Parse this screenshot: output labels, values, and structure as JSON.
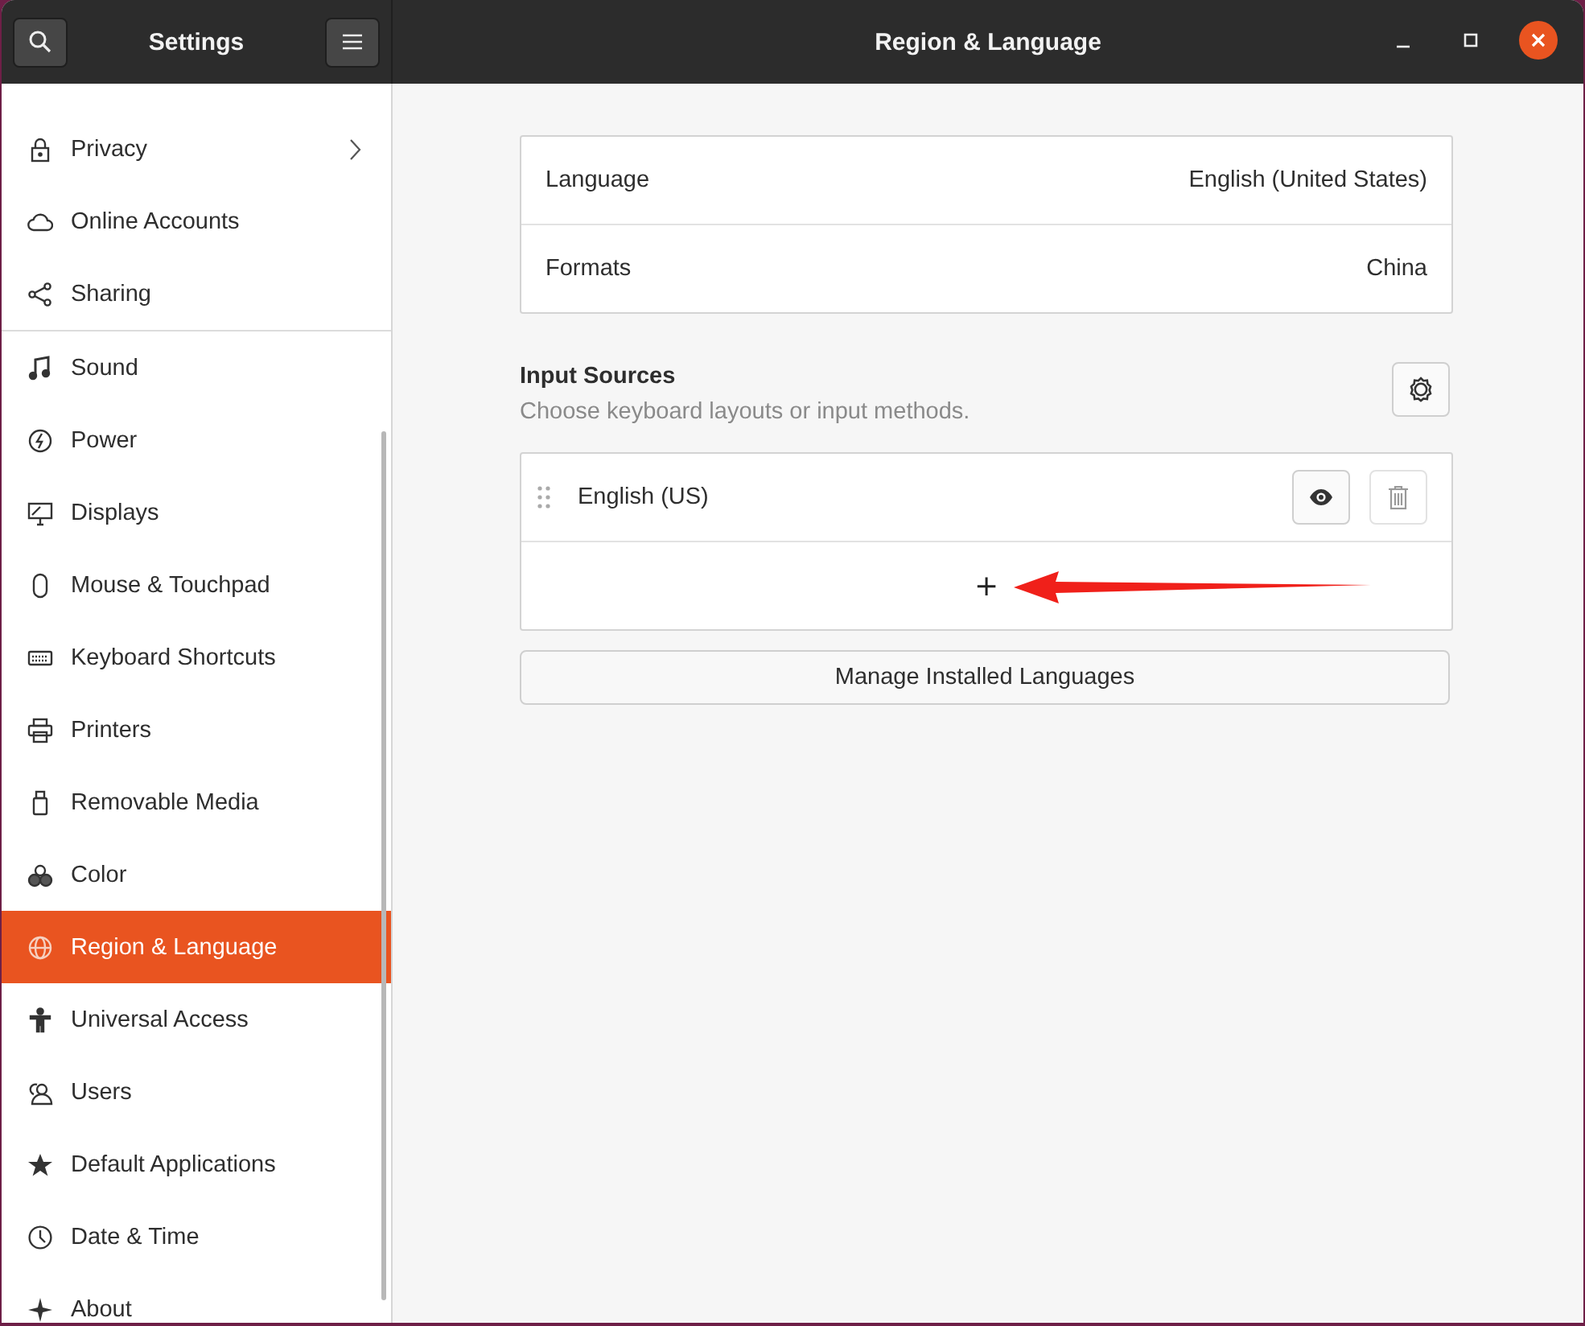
{
  "sidebar": {
    "title": "Settings",
    "items": [
      {
        "label": "Privacy",
        "has_arrow": true,
        "selected": false,
        "separator_after": false
      },
      {
        "label": "Online Accounts",
        "has_arrow": false,
        "selected": false,
        "separator_after": false
      },
      {
        "label": "Sharing",
        "has_arrow": false,
        "selected": false,
        "separator_after": true
      },
      {
        "label": "Sound",
        "has_arrow": false,
        "selected": false,
        "separator_after": false
      },
      {
        "label": "Power",
        "has_arrow": false,
        "selected": false,
        "separator_after": false
      },
      {
        "label": "Displays",
        "has_arrow": false,
        "selected": false,
        "separator_after": false
      },
      {
        "label": "Mouse & Touchpad",
        "has_arrow": false,
        "selected": false,
        "separator_after": false
      },
      {
        "label": "Keyboard Shortcuts",
        "has_arrow": false,
        "selected": false,
        "separator_after": false
      },
      {
        "label": "Printers",
        "has_arrow": false,
        "selected": false,
        "separator_after": false
      },
      {
        "label": "Removable Media",
        "has_arrow": false,
        "selected": false,
        "separator_after": false
      },
      {
        "label": "Color",
        "has_arrow": false,
        "selected": false,
        "separator_after": false
      },
      {
        "label": "Region & Language",
        "has_arrow": false,
        "selected": true,
        "separator_after": false
      },
      {
        "label": "Universal Access",
        "has_arrow": false,
        "selected": false,
        "separator_after": false
      },
      {
        "label": "Users",
        "has_arrow": false,
        "selected": false,
        "separator_after": false
      },
      {
        "label": "Default Applications",
        "has_arrow": false,
        "selected": false,
        "separator_after": false
      },
      {
        "label": "Date & Time",
        "has_arrow": false,
        "selected": false,
        "separator_after": false
      },
      {
        "label": "About",
        "has_arrow": false,
        "selected": false,
        "separator_after": false
      }
    ]
  },
  "window": {
    "title": "Region & Language"
  },
  "settings": [
    {
      "label": "Language",
      "value": "English (United States)"
    },
    {
      "label": "Formats",
      "value": "China"
    }
  ],
  "input_sources": {
    "title": "Input Sources",
    "subtitle": "Choose keyboard layouts or input methods.",
    "sources": [
      {
        "name": "English (US)"
      }
    ],
    "add_label": "+"
  },
  "manage_button": "Manage Installed Languages"
}
